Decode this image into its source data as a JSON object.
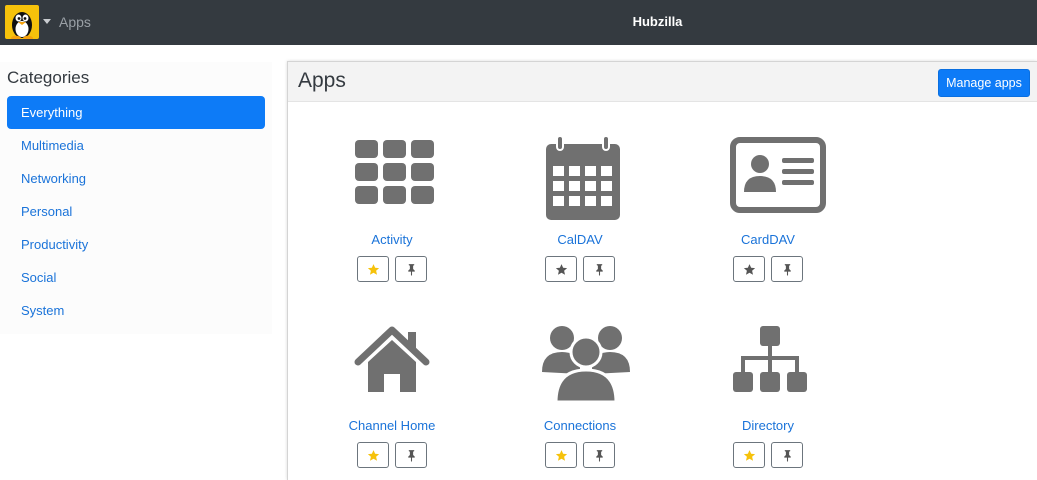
{
  "navbar": {
    "app_name": "Apps",
    "site_title": "Hubzilla",
    "avatar_icon": "penguin-avatar-icon"
  },
  "aside": {
    "title": "Categories",
    "items": [
      {
        "label": "Everything",
        "active": true
      },
      {
        "label": "Multimedia",
        "active": false
      },
      {
        "label": "Networking",
        "active": false
      },
      {
        "label": "Personal",
        "active": false
      },
      {
        "label": "Productivity",
        "active": false
      },
      {
        "label": "Social",
        "active": false
      },
      {
        "label": "System",
        "active": false
      }
    ]
  },
  "main": {
    "title": "Apps",
    "manage_label": "Manage apps",
    "apps": [
      {
        "name": "Activity",
        "icon": "grid-icon",
        "starred": true
      },
      {
        "name": "CalDAV",
        "icon": "calendar-icon",
        "starred": false
      },
      {
        "name": "CardDAV",
        "icon": "address-card-icon",
        "starred": false
      },
      {
        "name": "Channel Home",
        "icon": "home-icon",
        "starred": true
      },
      {
        "name": "Connections",
        "icon": "users-icon",
        "starred": true
      },
      {
        "name": "Directory",
        "icon": "sitemap-icon",
        "starred": true
      }
    ]
  },
  "colors": {
    "navbar": "#343a40",
    "accent": "#0d7bf7",
    "link": "#1a73d9",
    "icon": "#707070",
    "star_active": "#f6c20b",
    "star_inactive": "#555555"
  }
}
